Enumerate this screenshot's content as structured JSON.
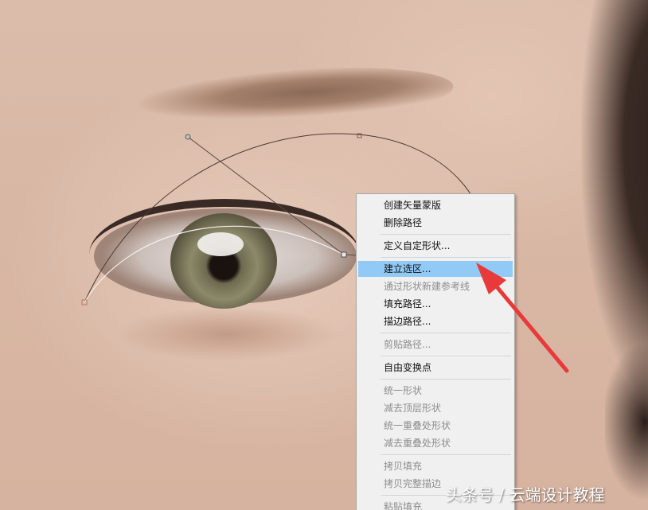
{
  "menu": {
    "items": [
      {
        "label": "创建矢量蒙版",
        "disabled": false
      },
      {
        "label": "删除路径",
        "disabled": false
      },
      {
        "label": "定义自定形状...",
        "disabled": false
      },
      {
        "label": "建立选区...",
        "disabled": false,
        "highlighted": true
      },
      {
        "label": "通过形状新建参考线",
        "disabled": true
      },
      {
        "label": "填充路径...",
        "disabled": false
      },
      {
        "label": "描边路径...",
        "disabled": false
      },
      {
        "label": "剪贴路径...",
        "disabled": true
      },
      {
        "label": "自由变换点",
        "disabled": false
      },
      {
        "label": "统一形状",
        "disabled": true
      },
      {
        "label": "减去顶层形状",
        "disabled": true
      },
      {
        "label": "统一重叠处形状",
        "disabled": true
      },
      {
        "label": "减去重叠处形状",
        "disabled": true
      },
      {
        "label": "拷贝填充",
        "disabled": true
      },
      {
        "label": "拷贝完整描边",
        "disabled": true
      },
      {
        "label": "粘贴填充",
        "disabled": true
      }
    ]
  },
  "watermark": "头条号 / 云端设计教程",
  "colors": {
    "menu_bg": "#f0f0f0",
    "highlight": "#91c9f7",
    "arrow": "#e83a3a",
    "disabled_text": "#8d8d8d"
  },
  "icons": [
    "red-arrow-annotation",
    "anchor-point",
    "direction-handle"
  ]
}
